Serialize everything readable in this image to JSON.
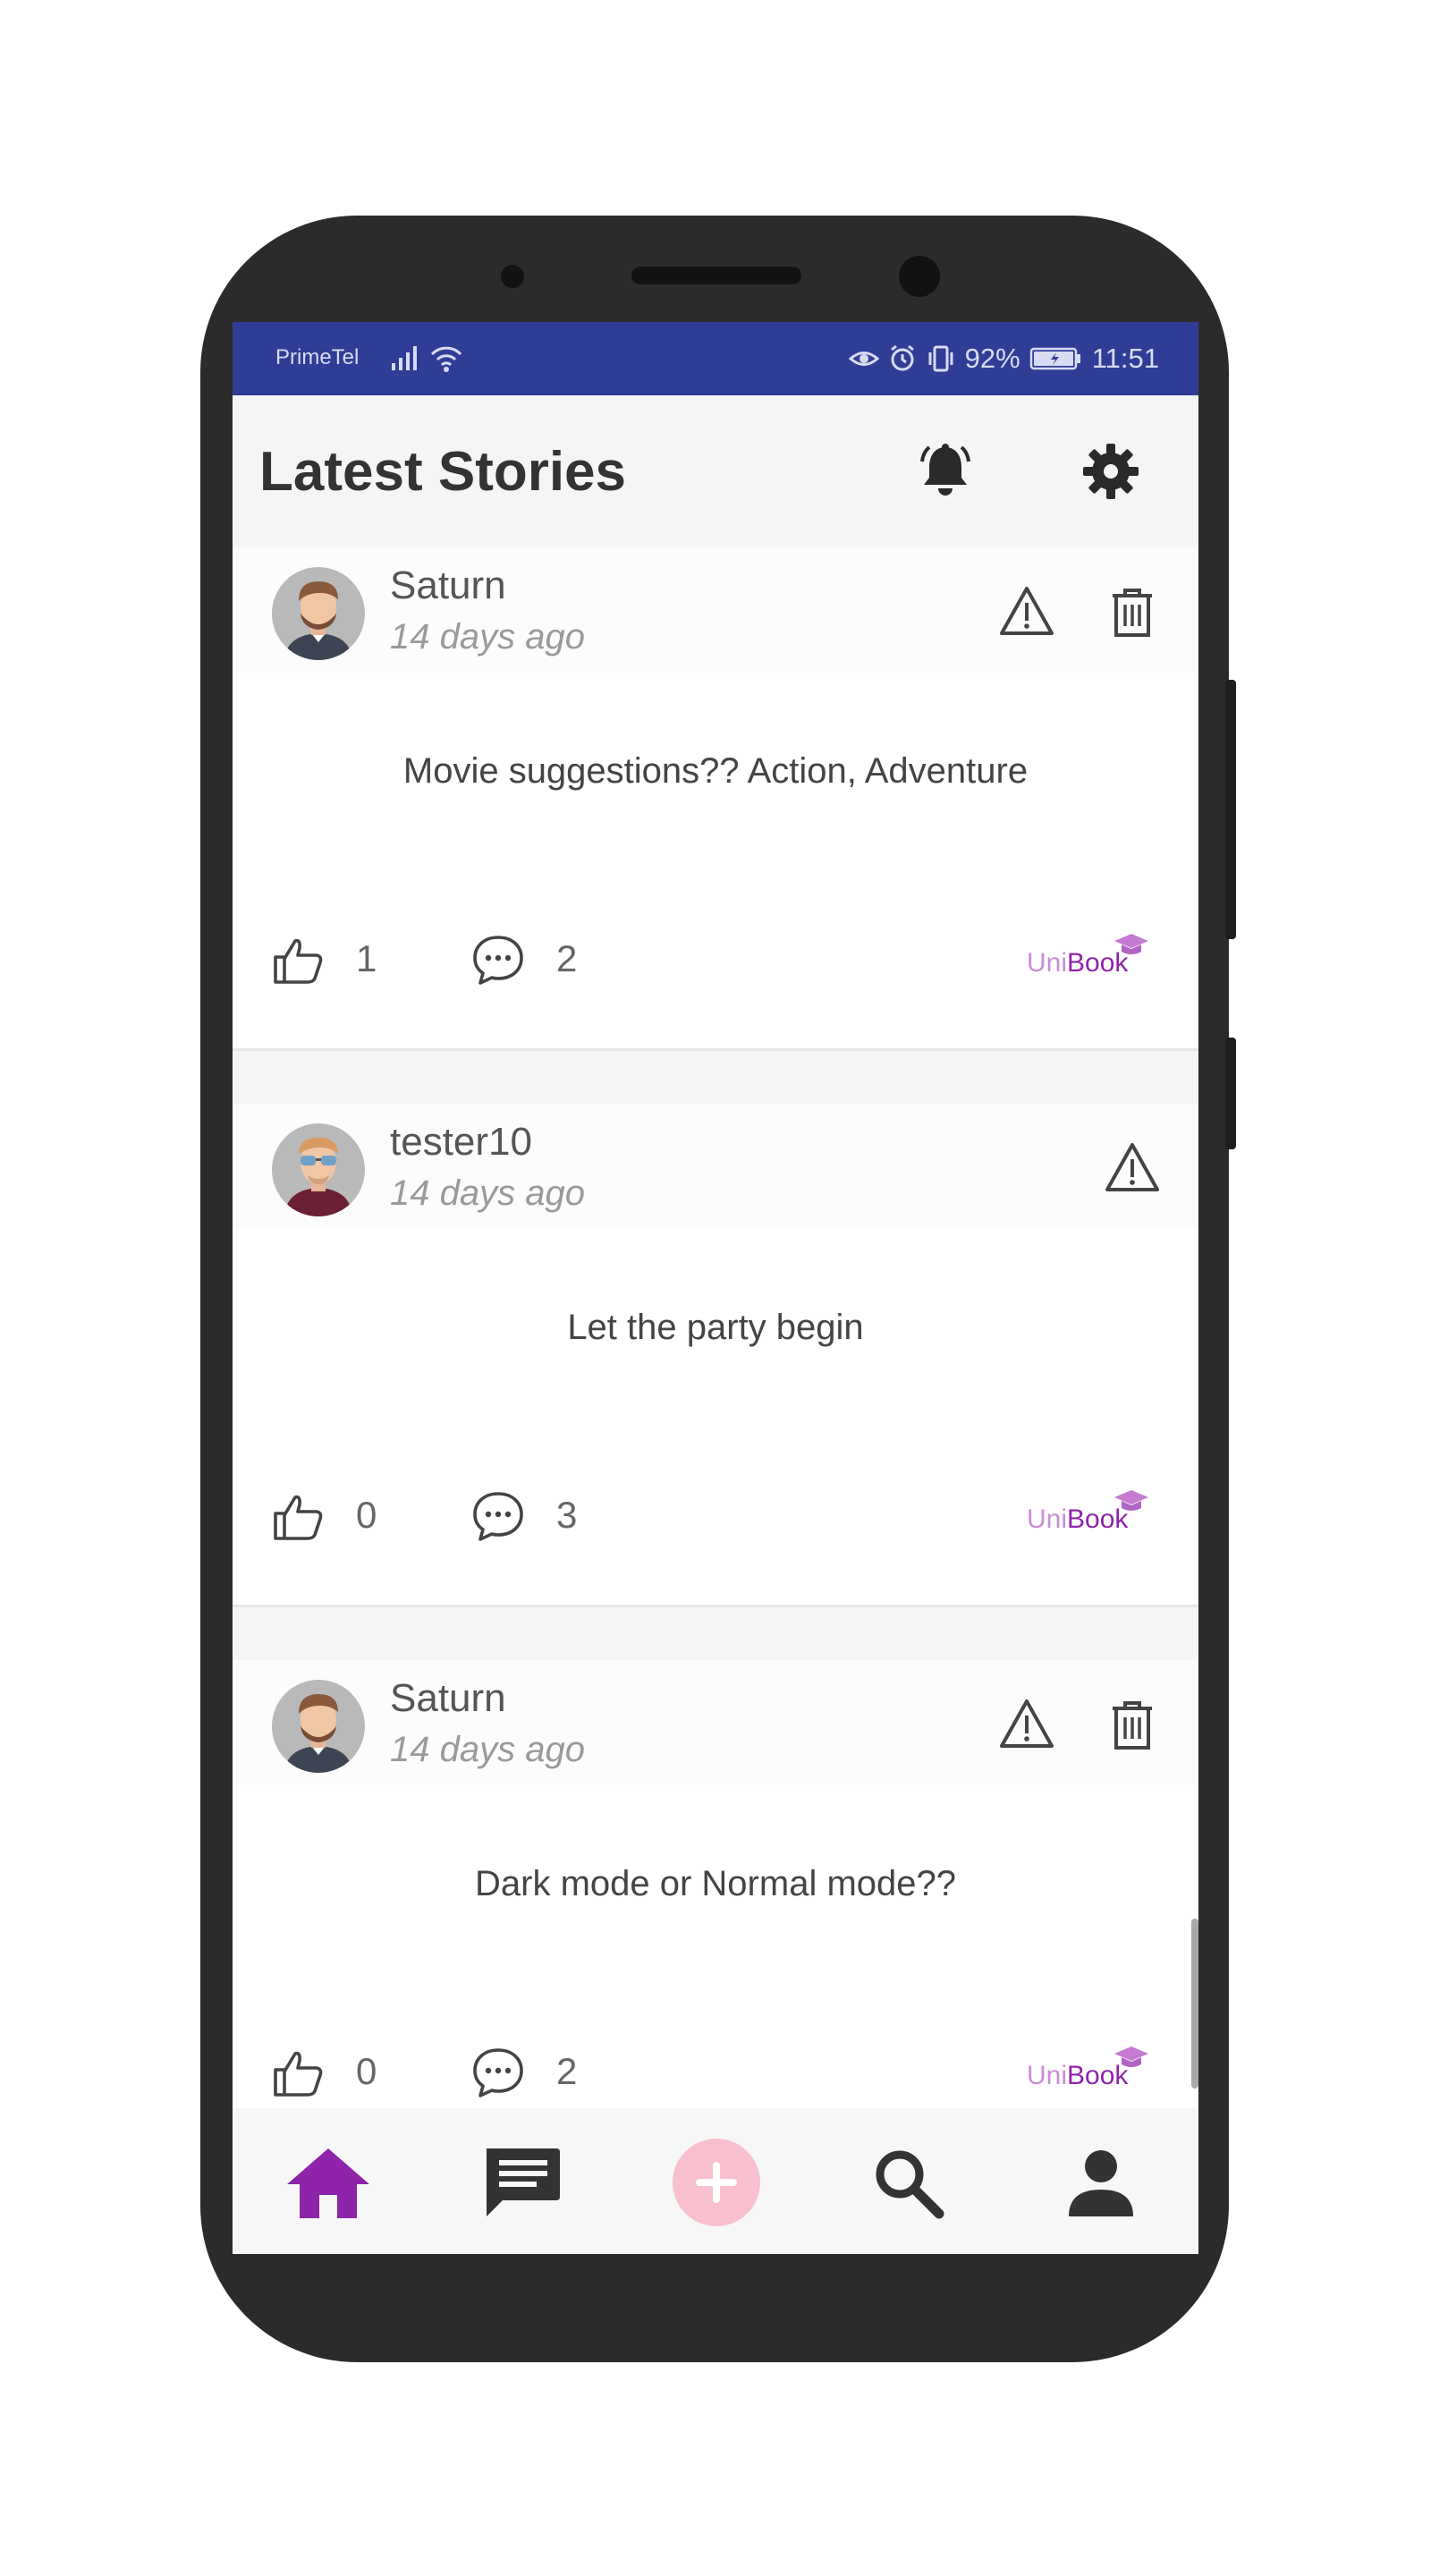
{
  "statusbar": {
    "carrier": "PrimeTel",
    "battery": "92%",
    "time": "11:51"
  },
  "header": {
    "title": "Latest Stories",
    "icons": [
      "bell-icon",
      "gear-icon"
    ]
  },
  "posts": [
    {
      "author": "Saturn",
      "time": "14 days ago",
      "text": "Movie suggestions?? Action, Adventure",
      "likes": "1",
      "comments": "2",
      "can_delete": true
    },
    {
      "author": "tester10",
      "time": "14 days ago",
      "text": "Let the party begin",
      "likes": "0",
      "comments": "3",
      "can_delete": false
    },
    {
      "author": "Saturn",
      "time": "14 days ago",
      "text": "Dark mode or Normal mode??",
      "likes": "0",
      "comments": "2",
      "can_delete": true
    }
  ],
  "brand": {
    "part1": "Uni",
    "part2": "Book"
  },
  "nav": {
    "items": [
      "home-icon",
      "chat-icon",
      "add-icon",
      "search-icon",
      "profile-icon"
    ],
    "active": "home-icon"
  },
  "colors": {
    "statusbar": "#2f3d96",
    "accent": "#8e24aa",
    "add_button": "#f8bfcf"
  }
}
